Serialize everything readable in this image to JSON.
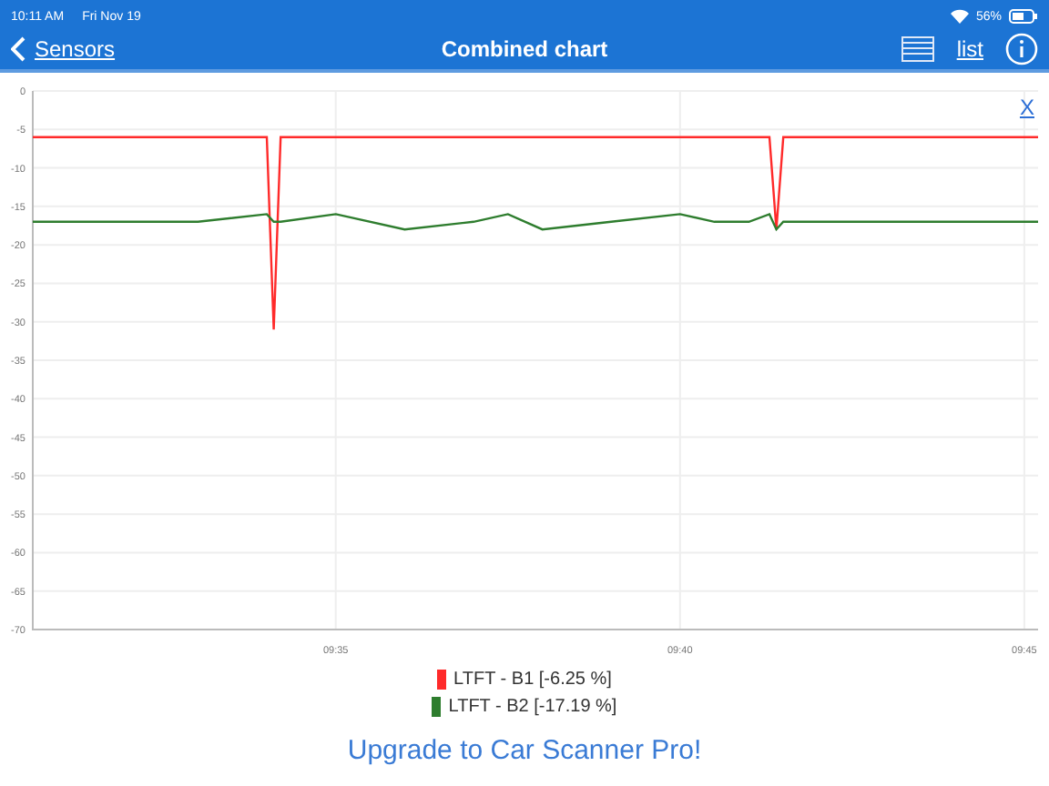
{
  "status_bar": {
    "time": "10:11 AM",
    "date": "Fri Nov 19",
    "battery": "56%"
  },
  "nav": {
    "back": "Sensors",
    "title": "Combined chart",
    "list": "list"
  },
  "chart": {
    "close": "X",
    "chart_data": {
      "type": "line",
      "grid": true,
      "xlim": [
        570.6,
        585.2
      ],
      "ylim": [
        -70,
        0
      ],
      "xticks": [
        {
          "value": 575,
          "label": "09:35"
        },
        {
          "value": 580,
          "label": "09:40"
        },
        {
          "value": 585,
          "label": "09:45"
        }
      ],
      "yticks": [
        0,
        -5,
        -10,
        -15,
        -20,
        -25,
        -30,
        -35,
        -40,
        -45,
        -50,
        -55,
        -60,
        -65,
        -70
      ],
      "x": [
        570.6,
        571,
        572,
        573,
        574,
        574.1,
        574.2,
        575,
        576,
        577,
        577.5,
        578,
        579,
        580,
        580.5,
        581,
        581.3,
        581.4,
        581.5,
        582,
        582.5,
        583,
        584,
        585,
        585.2
      ],
      "series": [
        {
          "name": "LTFT - B1 [-6.25 %]",
          "color": "#ff2a2a",
          "values": [
            -6,
            -6,
            -6,
            -6,
            -6,
            -31,
            -6,
            -6,
            -6,
            -6,
            -6,
            -6,
            -6,
            -6,
            -6,
            -6,
            -6,
            -18,
            -6,
            -6,
            -6,
            -6,
            -6,
            -6,
            -6
          ]
        },
        {
          "name": "LTFT - B2 [-17.19 %]",
          "color": "#2e7d2e",
          "values": [
            -17,
            -17,
            -17,
            -17,
            -16,
            -17,
            -17,
            -16,
            -18,
            -17,
            -16,
            -18,
            -17,
            -16,
            -17,
            -17,
            -16,
            -18,
            -17,
            -17,
            -17,
            -17,
            -17,
            -17,
            -17
          ]
        }
      ]
    }
  },
  "upgrade": "Upgrade to Car Scanner Pro!"
}
